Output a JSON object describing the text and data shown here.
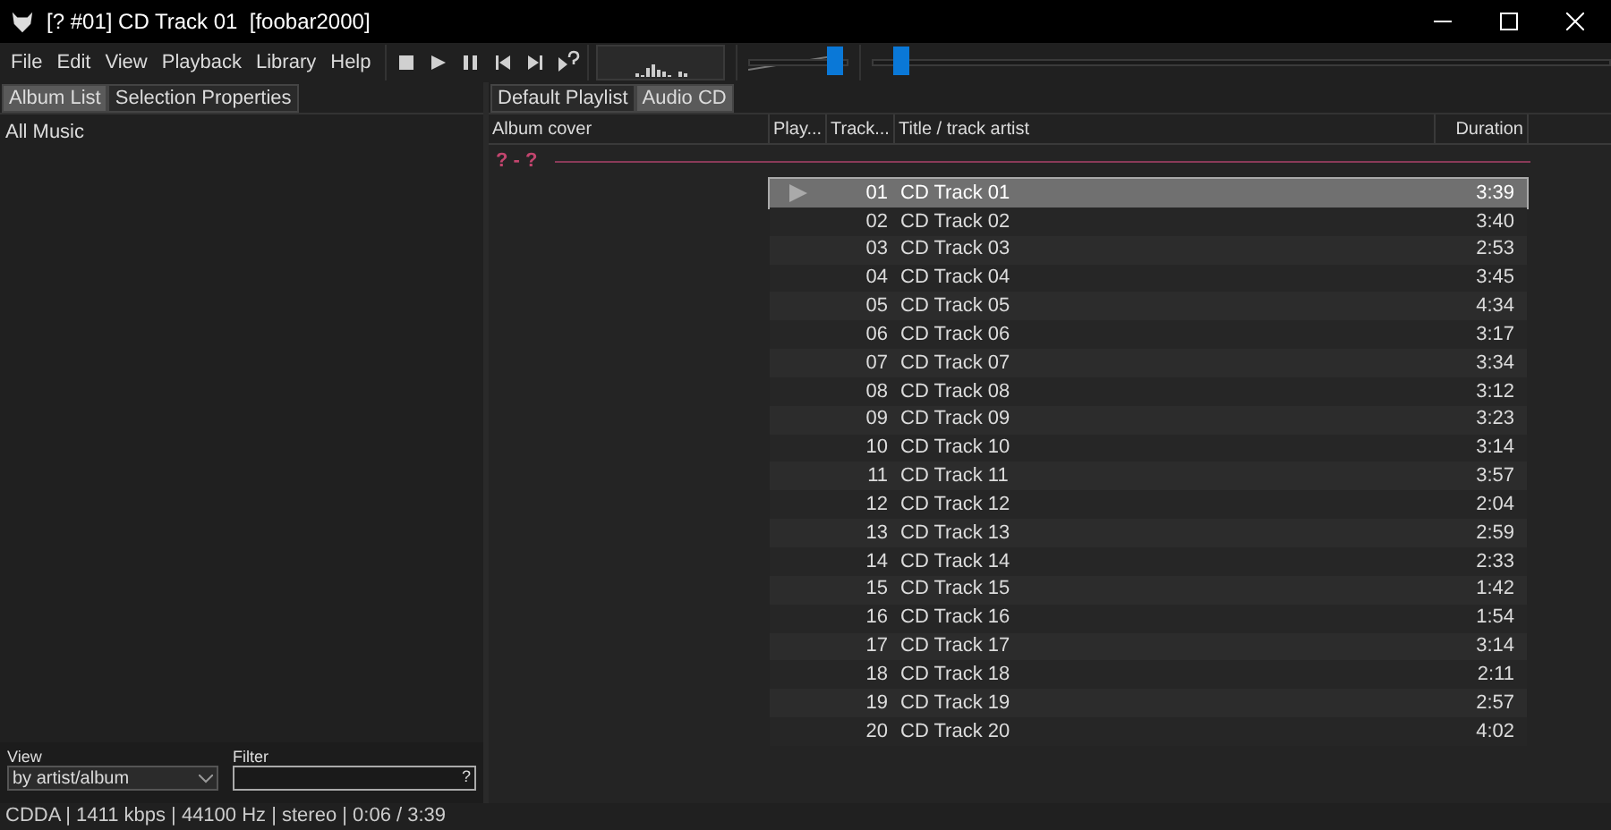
{
  "window": {
    "title": "[? #01] CD Track 01  [foobar2000]"
  },
  "menu": [
    "File",
    "Edit",
    "View",
    "Playback",
    "Library",
    "Help"
  ],
  "volume": {
    "level": 0.95
  },
  "seek": {
    "level": 0.03
  },
  "left_tabs": [
    {
      "label": "Album List",
      "selected": true
    },
    {
      "label": "Selection Properties",
      "selected": false
    }
  ],
  "tree": {
    "items": [
      "All Music"
    ]
  },
  "view": {
    "label": "View",
    "value": "by artist/album"
  },
  "filter": {
    "label": "Filter",
    "help": "?"
  },
  "playlist_tabs": [
    {
      "label": "Default Playlist",
      "selected": false
    },
    {
      "label": "Audio CD",
      "selected": true
    }
  ],
  "columns": [
    "Album cover",
    "Play...",
    "Track...",
    "Title / track artist",
    "Duration"
  ],
  "group": "? - ?",
  "rows": [
    {
      "track": "01",
      "title": "CD Track 01",
      "duration": "3:39",
      "selected": true,
      "playing": true
    },
    {
      "track": "02",
      "title": "CD Track 02",
      "duration": "3:40",
      "selected": false,
      "playing": false
    },
    {
      "track": "03",
      "title": "CD Track 03",
      "duration": "2:53",
      "selected": false,
      "playing": false
    },
    {
      "track": "04",
      "title": "CD Track 04",
      "duration": "3:45",
      "selected": false,
      "playing": false
    },
    {
      "track": "05",
      "title": "CD Track 05",
      "duration": "4:34",
      "selected": false,
      "playing": false
    },
    {
      "track": "06",
      "title": "CD Track 06",
      "duration": "3:17",
      "selected": false,
      "playing": false
    },
    {
      "track": "07",
      "title": "CD Track 07",
      "duration": "3:34",
      "selected": false,
      "playing": false
    },
    {
      "track": "08",
      "title": "CD Track 08",
      "duration": "3:12",
      "selected": false,
      "playing": false
    },
    {
      "track": "09",
      "title": "CD Track 09",
      "duration": "3:23",
      "selected": false,
      "playing": false
    },
    {
      "track": "10",
      "title": "CD Track 10",
      "duration": "3:14",
      "selected": false,
      "playing": false
    },
    {
      "track": "11",
      "title": "CD Track 11",
      "duration": "3:57",
      "selected": false,
      "playing": false
    },
    {
      "track": "12",
      "title": "CD Track 12",
      "duration": "2:04",
      "selected": false,
      "playing": false
    },
    {
      "track": "13",
      "title": "CD Track 13",
      "duration": "2:59",
      "selected": false,
      "playing": false
    },
    {
      "track": "14",
      "title": "CD Track 14",
      "duration": "2:33",
      "selected": false,
      "playing": false
    },
    {
      "track": "15",
      "title": "CD Track 15",
      "duration": "1:42",
      "selected": false,
      "playing": false
    },
    {
      "track": "16",
      "title": "CD Track 16",
      "duration": "1:54",
      "selected": false,
      "playing": false
    },
    {
      "track": "17",
      "title": "CD Track 17",
      "duration": "3:14",
      "selected": false,
      "playing": false
    },
    {
      "track": "18",
      "title": "CD Track 18",
      "duration": "2:11",
      "selected": false,
      "playing": false
    },
    {
      "track": "19",
      "title": "CD Track 19",
      "duration": "2:57",
      "selected": false,
      "playing": false
    },
    {
      "track": "20",
      "title": "CD Track 20",
      "duration": "4:02",
      "selected": false,
      "playing": false
    }
  ],
  "status_bar": "CDDA | 1411 kbps | 44100 Hz | stereo | 0:06 / 3:39"
}
